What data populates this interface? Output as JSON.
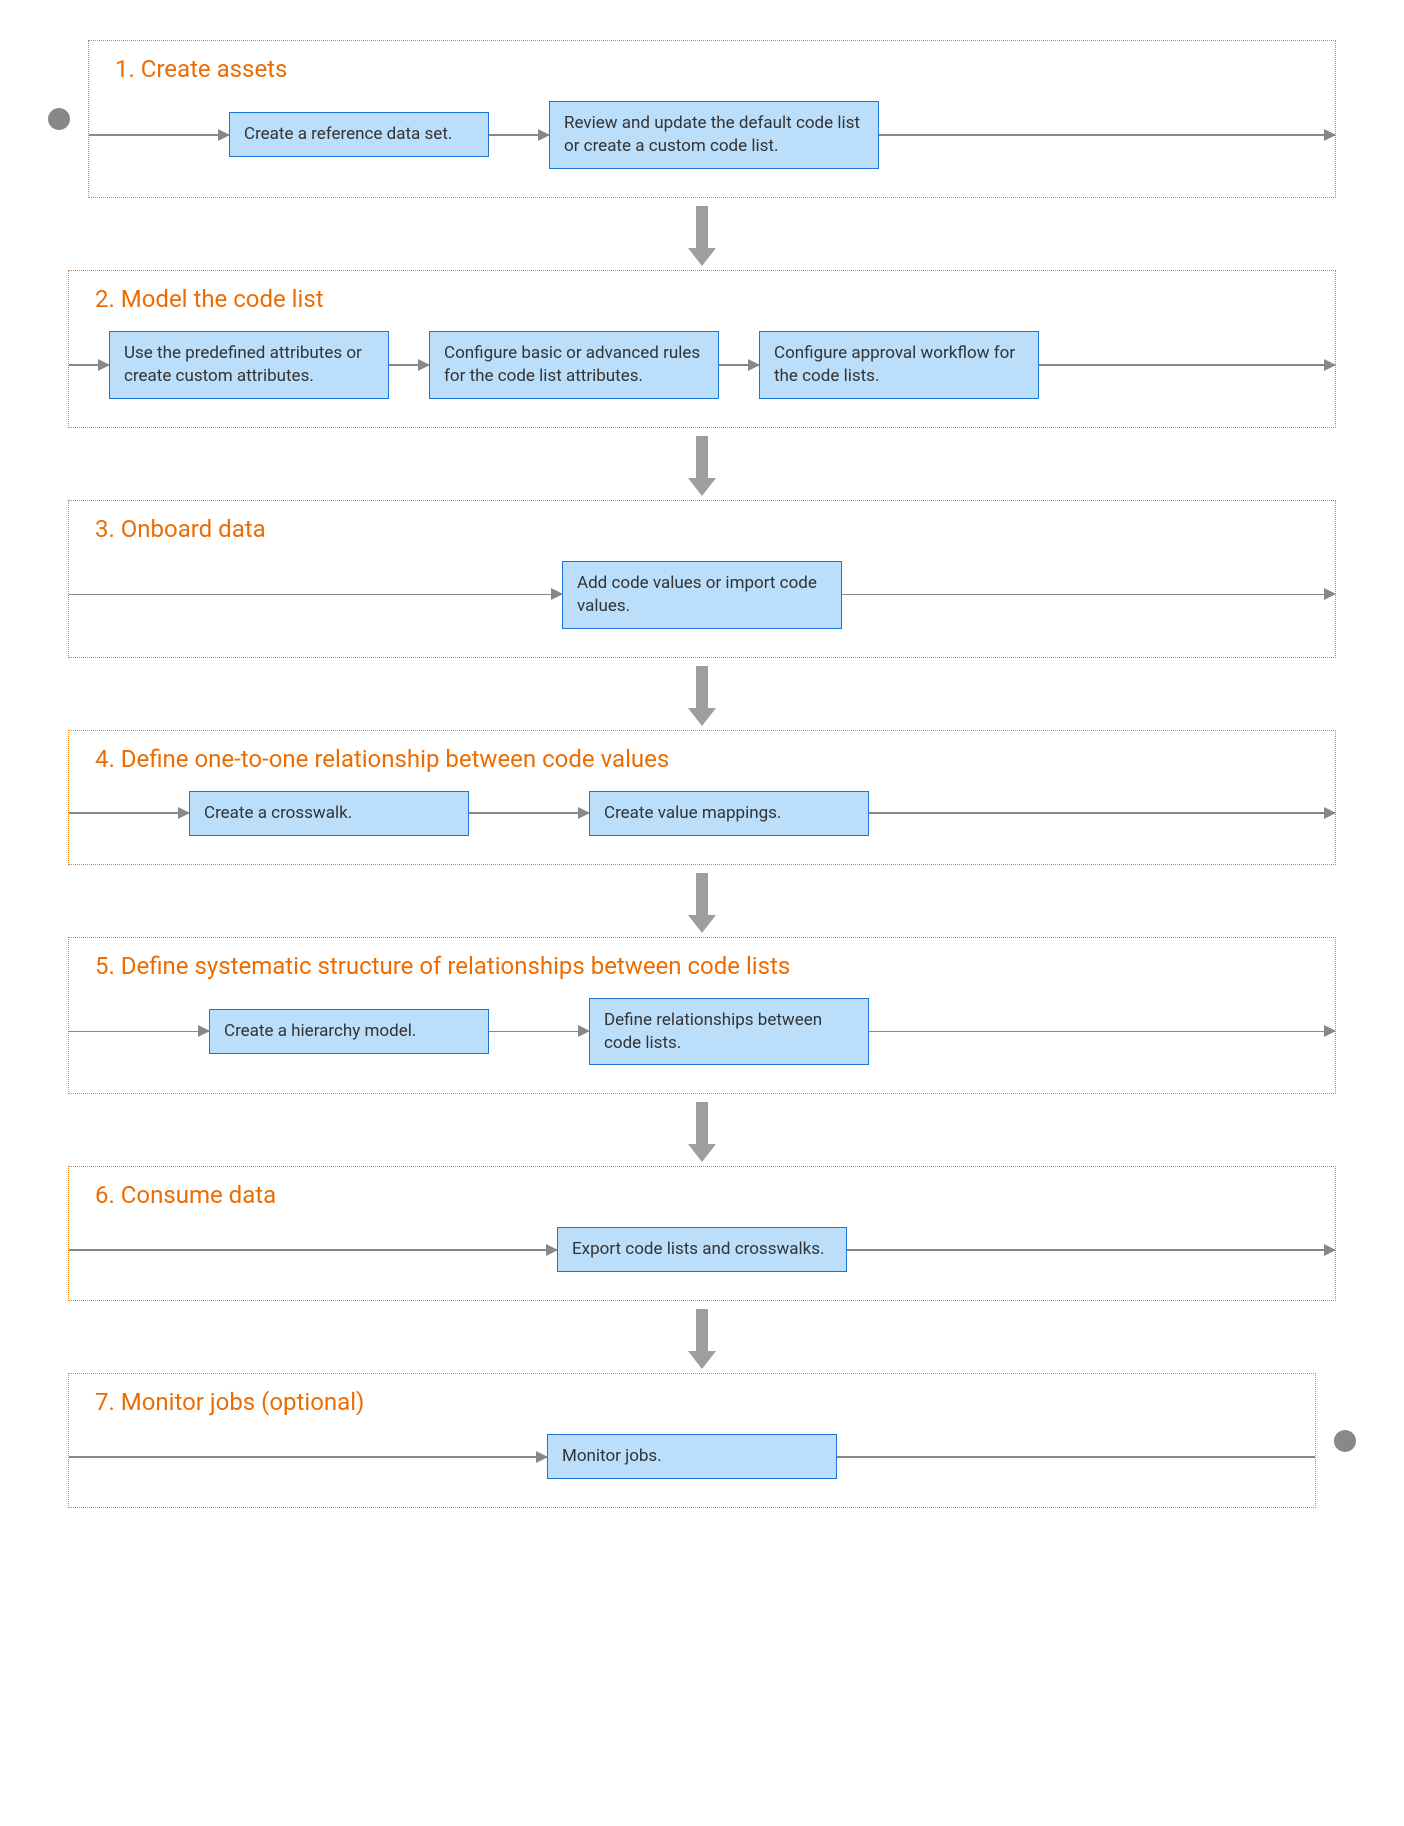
{
  "stages": [
    {
      "title": "1. Create assets",
      "steps": [
        "Create a reference data set.",
        "Review and update the default code list or create a custom code list."
      ]
    },
    {
      "title": "2. Model the code list",
      "steps": [
        "Use the predefined attributes or create custom attributes.",
        "Configure basic or advanced rules for the code list attributes.",
        "Configure approval workflow for the code lists."
      ]
    },
    {
      "title": "3. Onboard data",
      "steps": [
        "Add code values or import code values."
      ]
    },
    {
      "title": "4. Define one-to-one relationship between code values",
      "steps": [
        "Create a crosswalk.",
        "Create value mappings."
      ]
    },
    {
      "title": "5. Define systematic structure of relationships between code lists",
      "steps": [
        "Create a hierarchy model.",
        "Define relationships between code lists."
      ]
    },
    {
      "title": "6. Consume data",
      "steps": [
        "Export code lists and crosswalks."
      ]
    },
    {
      "title": "7. Monitor jobs (optional)",
      "steps": [
        "Monitor jobs."
      ]
    }
  ]
}
